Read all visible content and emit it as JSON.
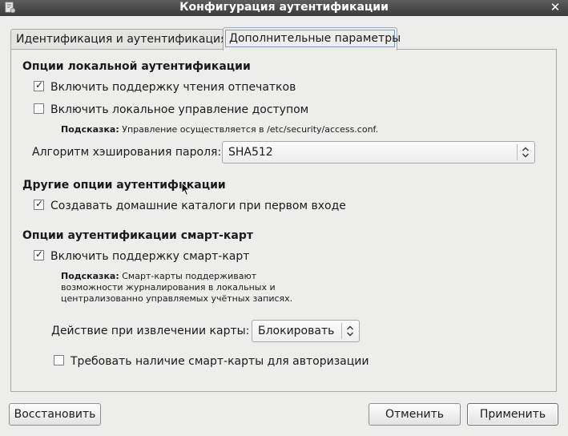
{
  "window": {
    "title": "Конфигурация аутентификации",
    "close_glyph": "✕"
  },
  "tabs": [
    {
      "label": "Идентификация и аутентификация",
      "active": false
    },
    {
      "label": "Дополнительные параметры",
      "active": true
    }
  ],
  "local_auth": {
    "title": "Опции локальной аутентификации",
    "fingerprint": {
      "label": "Включить поддержку чтения отпечатков",
      "checked": true
    },
    "access_control": {
      "label": "Включить локальное управление доступом",
      "checked": false
    },
    "hint_prefix": "Подсказка:",
    "hint_text": "Управление осуществляется в /etc/security/access.conf.",
    "hash_label": "Алгоритм хэширования пароля:",
    "hash_value": "SHA512"
  },
  "other_auth": {
    "title": "Другие опции аутентификации",
    "homedir": {
      "label": "Создавать домашние каталоги при первом входе",
      "checked": true
    }
  },
  "smartcard": {
    "title": "Опции аутентификации смарт-карт",
    "enable": {
      "label": "Включить поддержку смарт-карт",
      "checked": true
    },
    "hint_prefix": "Подсказка:",
    "hint_line1": "Смарт-карты поддерживают",
    "hint_line2": "возможности журналирования в локальных и",
    "hint_line3": "централизованно управляемых учётных записях.",
    "removal_label": "Действие при извлечении карты:",
    "removal_value": "Блокировать",
    "require": {
      "label": "Требовать наличие смарт-карты для авторизации",
      "checked": false
    }
  },
  "buttons": {
    "restore": "Восстановить",
    "cancel": "Отменить",
    "apply": "Применить"
  },
  "check_glyph": "✓"
}
